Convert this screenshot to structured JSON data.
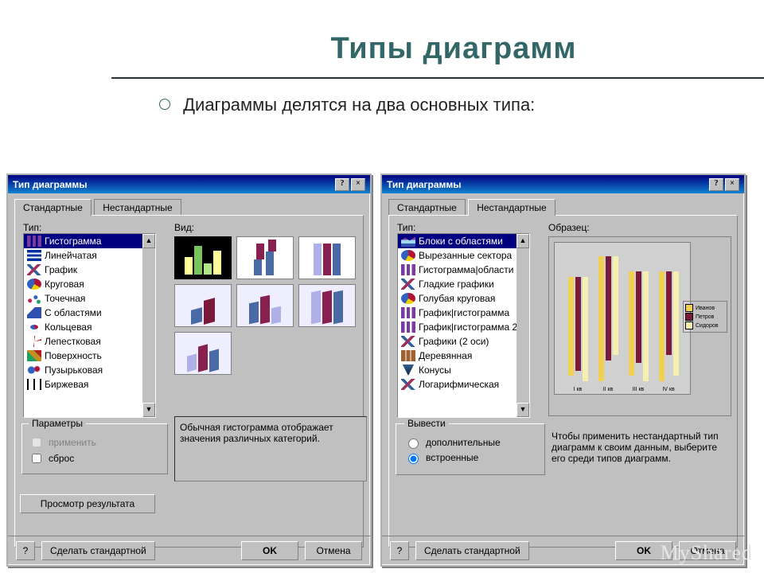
{
  "slide": {
    "title": "Типы диаграмм",
    "subtitle": "Диаграммы делятся на два основных типа:"
  },
  "dialog_left": {
    "caption": "Тип диаграммы",
    "tabs": {
      "standard": "Стандартные",
      "custom": "Нестандартные"
    },
    "type_label": "Тип:",
    "view_label": "Вид:",
    "types": [
      "Гистограмма",
      "Линейчатая",
      "График",
      "Круговая",
      "Точечная",
      "С областями",
      "Кольцевая",
      "Лепестковая",
      "Поверхность",
      "Пузырьковая",
      "Биржевая"
    ],
    "selected_type_index": 0,
    "description": "Обычная гистограмма отображает значения различных категорий.",
    "params_caption": "Параметры",
    "param_apply": "применить",
    "param_reset": "сброс",
    "preview_button": "Просмотр результата",
    "make_standard": "Сделать стандартной",
    "ok": "OK",
    "cancel": "Отмена",
    "type_icons": [
      "ic-bars",
      "ic-hbars",
      "ic-line",
      "ic-pie",
      "ic-dots",
      "ic-area",
      "ic-ring",
      "ic-radar",
      "ic-surf",
      "ic-bubble",
      "ic-stock"
    ]
  },
  "dialog_right": {
    "caption": "Тип диаграммы",
    "tabs": {
      "standard": "Стандартные",
      "custom": "Нестандартные"
    },
    "type_label": "Тип:",
    "sample_label": "Образец:",
    "types": [
      "Блоки с областями",
      "Вырезанные сектора",
      "Гистограмма|области",
      "Гладкие графики",
      "Голубая круговая",
      "График|гистограмма",
      "График|гистограмма 2",
      "Графики (2 оси)",
      "Деревянная",
      "Конусы",
      "Логарифмическая"
    ],
    "selected_type_index": 0,
    "type_icons": [
      "ic-areastack",
      "ic-pie",
      "ic-bars",
      "ic-line",
      "ic-pie",
      "ic-bars",
      "ic-bars",
      "ic-line",
      "ic-wood",
      "ic-cone",
      "ic-line"
    ],
    "output_caption": "Вывести",
    "output_additional": "дополнительные",
    "output_builtin": "встроенные",
    "description": "Чтобы применить нестандартный тип диаграмм к своим данным, выберите его среди типов диаграмм.",
    "make_standard": "Сделать стандартной",
    "ok": "OK",
    "cancel": "Отмена"
  },
  "chart_data": {
    "type": "bar",
    "title": "",
    "categories": [
      "I кв",
      "II кв",
      "III кв",
      "IV кв"
    ],
    "series": [
      {
        "name": "Иванов",
        "values": [
          38,
          48,
          40,
          42
        ]
      },
      {
        "name": "Петров",
        "values": [
          36,
          40,
          35,
          32
        ]
      },
      {
        "name": "Сидоров",
        "values": [
          40,
          38,
          42,
          40
        ]
      }
    ],
    "ylim": [
      0,
      50
    ],
    "xlabel": "",
    "ylabel": ""
  },
  "watermark": "MyShared"
}
